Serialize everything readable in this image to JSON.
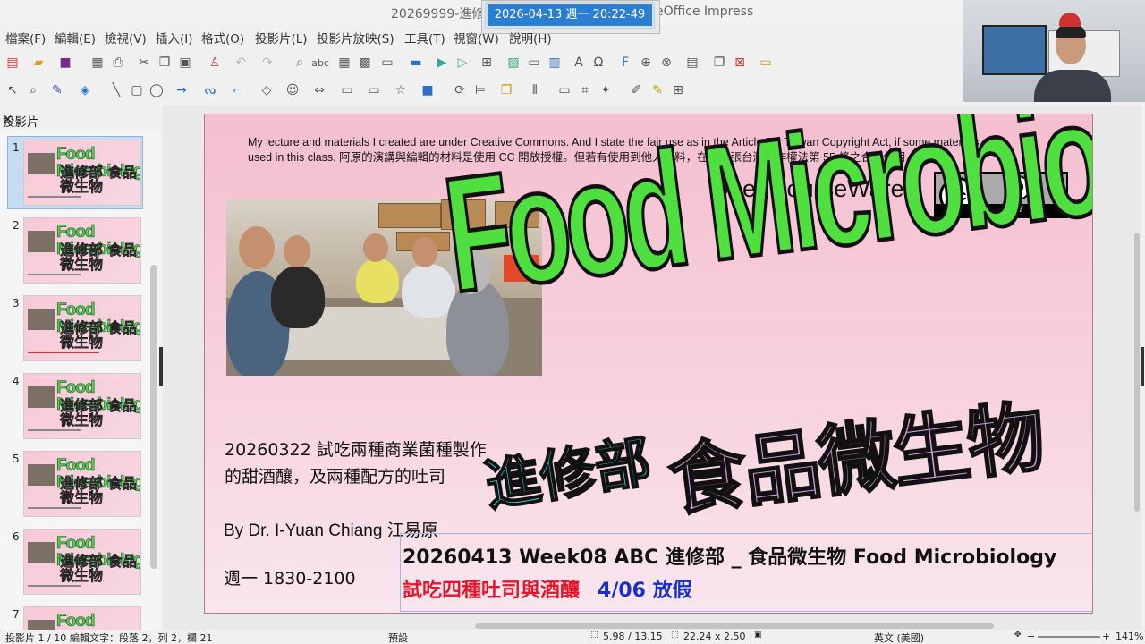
{
  "window": {
    "title_left": "20269999-進修部",
    "title_right": "eOffice Impress",
    "clock": "2026-04-13 週一 20:22-49"
  },
  "menu": [
    "檔案(F)",
    "編輯(E)",
    "檢視(V)",
    "插入(I)",
    "格式(O)",
    "投影片(L)",
    "投影片放映(S)",
    "工具(T)",
    "視窗(W)",
    "說明(H)"
  ],
  "panel": {
    "title": "投影片",
    "close": "×",
    "slides": [
      "1",
      "2",
      "3",
      "4",
      "5",
      "6",
      "7"
    ]
  },
  "slide": {
    "license": "My lecture and materials I created are under Creative Commons. And I  state the fair use as in the Article 55, Taiwan Copyright Act, if some materials are used in this class.  阿原的演講與編輯的材料是使用 CC 開放授權。但若有使用到他人材料，在此主張台灣著作權法第  55  條之合理使用",
    "ocw": "OpenCourseWare",
    "cc_label": "cc",
    "by_icon": "person-icon",
    "by_label": "BY",
    "big_title_en": "Food Microbiology",
    "big_title_zh1": "進修部",
    "big_title_zh2": "食品微生物",
    "description_line1": "20260322 試吃兩種商業菌種製作",
    "description_line2": "的甜酒釀，及兩種配方的吐司",
    "author": "By Dr. I-Yuan Chiang 江易原",
    "time": "週一  1830-2100",
    "textbox_line1": "20260413 Week08 ABC  進修部 _ 食品微生物  Food Microbiology",
    "textbox_line2_red": "試吃四種吐司與酒釀",
    "textbox_line2_blue": "4/06  放假"
  },
  "status": {
    "slide": "投影片 1 / 10",
    "edit": "編輯文字：段落 2，列 2，欄 21",
    "layout": "預設",
    "position": "5.98 / 13.15",
    "size": "22.24 x 2.50",
    "lang": "英文 (美國)",
    "zoom_minus": "−",
    "zoom_plus": "+",
    "zoom": "141%"
  }
}
